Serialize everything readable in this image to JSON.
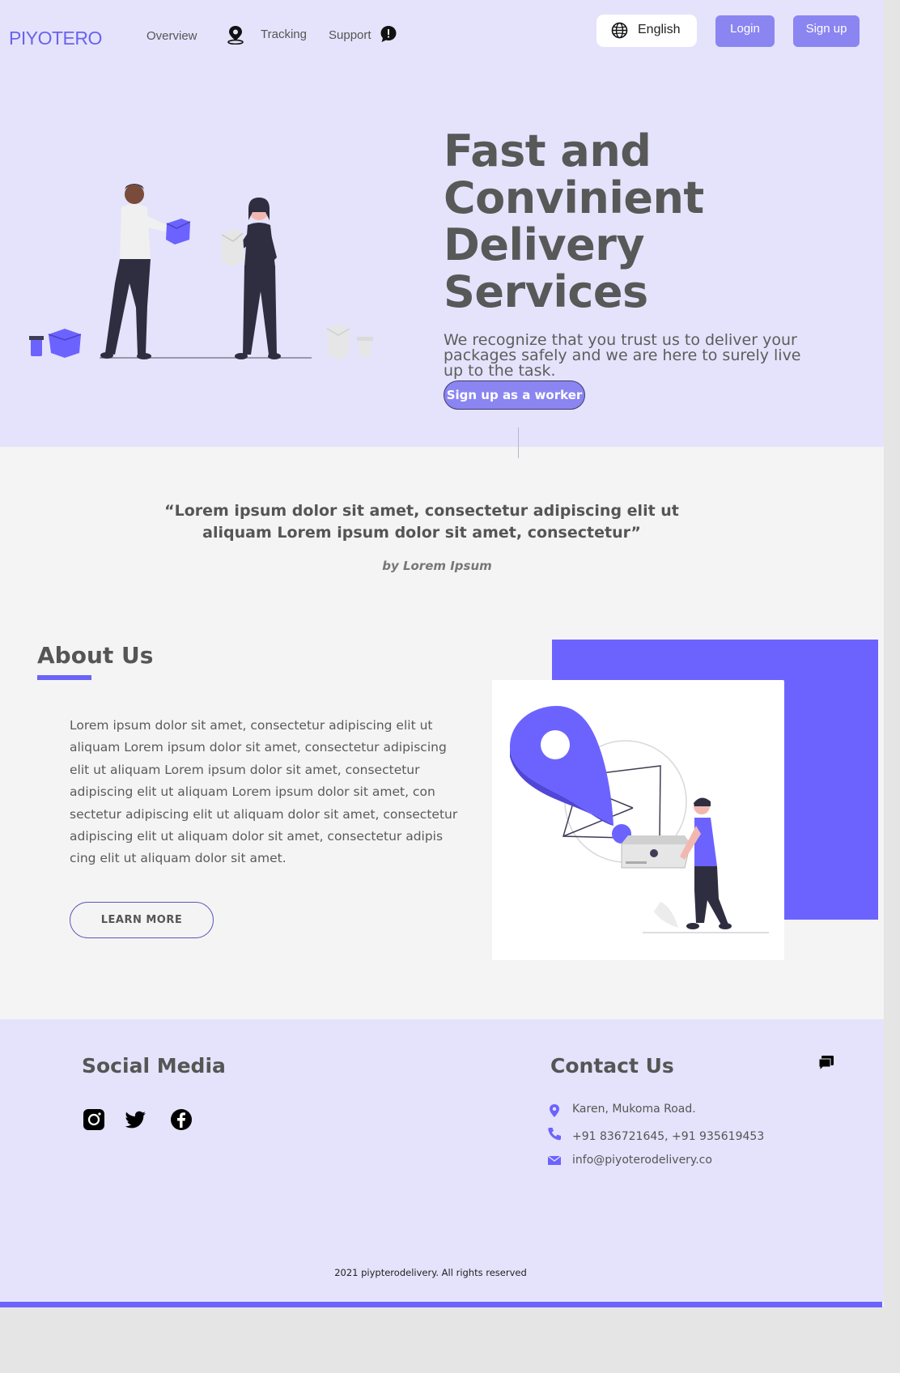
{
  "nav": {
    "logo": "PIYOTERO",
    "overview": "Overview",
    "tracking": "Tracking",
    "support": "Support",
    "language": "English",
    "login": "Login",
    "signup": "Sign up"
  },
  "hero": {
    "title_lines": [
      "Fast and",
      "Convinient",
      "Delivery",
      "Services"
    ],
    "subtitle": "We recognize that you trust us to deliver your packages safely and we are here to surely live up to the task.",
    "cta": "Sign up as a worker"
  },
  "quote": {
    "text": "“Lorem ipsum dolor sit amet, consectetur adipiscing elit ut aliquam Lorem ipsum dolor sit amet, consectetur”",
    "author": "by Lorem Ipsum"
  },
  "about": {
    "title": "About Us",
    "body": "Lorem ipsum dolor sit amet, consectetur adipiscing elit ut aliquam Lorem ipsum dolor sit amet, consectetur adipiscing elit ut aliquam Lorem ipsum dolor sit amet, consectetur adipiscing elit ut aliquam Lorem ipsum dolor sit amet, con sectetur adipiscing elit ut aliquam dolor sit amet, consectetur adipiscing elit ut aliquam dolor sit amet, consectetur adipis cing elit ut aliquam dolor sit amet.",
    "button": "LEARN  MORE"
  },
  "footer": {
    "social_title": "Social Media",
    "social_icons": [
      "instagram-icon",
      "twitter-icon",
      "facebook-icon"
    ],
    "contact_title": "Contact Us",
    "address": "Karen, Mukoma Road.",
    "phone": "+91 836721645, +91 935619453",
    "email": "info@piyoterodelivery.co",
    "copyright": "2021 piypterodelivery. All rights reserved"
  },
  "colors": {
    "accent": "#6c63ff",
    "button": "#8b85f2",
    "hero_bg": "#e4e3fb",
    "text": "#555555"
  }
}
